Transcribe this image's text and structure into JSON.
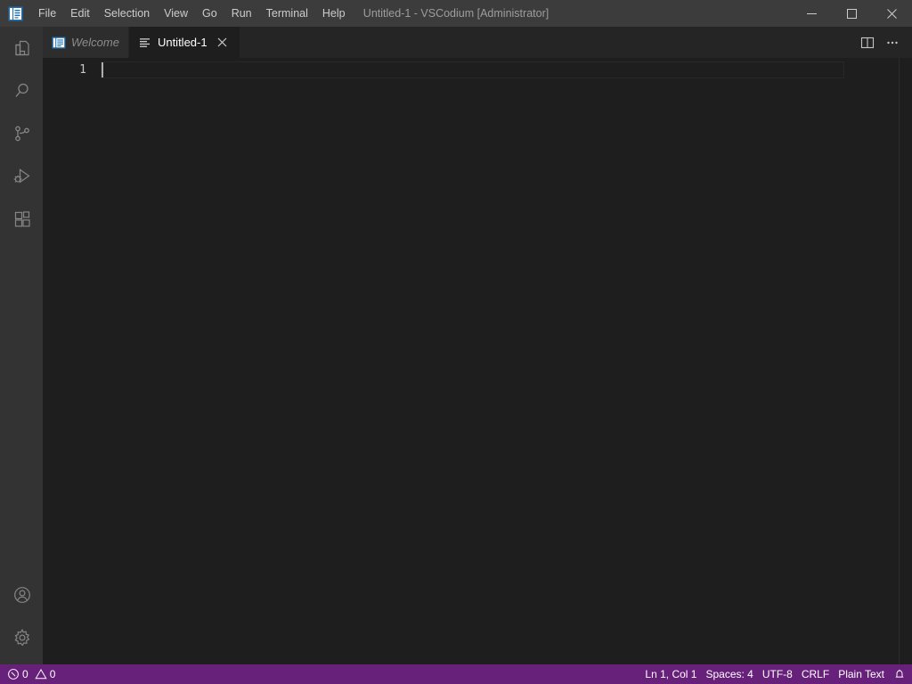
{
  "window": {
    "title": "Untitled-1 - VSCodium [Administrator]",
    "logo_icon": "vscodium-logo-icon",
    "controls": [
      {
        "name": "minimize-button",
        "icon": "minimize-icon",
        "label": "Minimize"
      },
      {
        "name": "maximize-button",
        "icon": "maximize-icon",
        "label": "Maximize"
      },
      {
        "name": "close-button",
        "icon": "close-icon",
        "label": "Close"
      }
    ]
  },
  "menubar": {
    "items": [
      {
        "label": "File"
      },
      {
        "label": "Edit"
      },
      {
        "label": "Selection"
      },
      {
        "label": "View"
      },
      {
        "label": "Go"
      },
      {
        "label": "Run"
      },
      {
        "label": "Terminal"
      },
      {
        "label": "Help"
      }
    ]
  },
  "activitybar": {
    "top_items": [
      {
        "name": "activity-explorer",
        "icon": "files-icon",
        "title": "Explorer",
        "active": false
      },
      {
        "name": "activity-search",
        "icon": "search-icon",
        "title": "Search",
        "active": false
      },
      {
        "name": "activity-source-control",
        "icon": "source-control-icon",
        "title": "Source Control",
        "active": false
      },
      {
        "name": "activity-run-debug",
        "icon": "run-and-debug-icon",
        "title": "Run and Debug",
        "active": false
      },
      {
        "name": "activity-extensions",
        "icon": "extensions-icon",
        "title": "Extensions",
        "active": false
      }
    ],
    "bottom_items": [
      {
        "name": "activity-accounts",
        "icon": "account-icon",
        "title": "Accounts"
      },
      {
        "name": "activity-settings",
        "icon": "gear-icon",
        "title": "Manage"
      }
    ]
  },
  "tabs": [
    {
      "label": "Welcome",
      "icon": "welcome-preview-icon",
      "active": false,
      "preview": true,
      "closable": false
    },
    {
      "label": "Untitled-1",
      "icon": "plaintext-file-icon",
      "active": true,
      "preview": false,
      "closable": true
    }
  ],
  "editor_actions": [
    {
      "name": "split-editor-right-button",
      "icon": "split-editor-icon",
      "label": "Split Editor Right"
    },
    {
      "name": "more-actions-button",
      "icon": "ellipsis-icon",
      "label": "More Actions..."
    }
  ],
  "editor": {
    "line_numbers": [
      "1"
    ],
    "content": "",
    "cursor_line": 1
  },
  "statusbar": {
    "problems": {
      "errors_icon": "error-icon",
      "errors": "0",
      "warnings_icon": "warning-icon",
      "warnings": "0"
    },
    "right_items": [
      {
        "name": "status-cursor-position",
        "label": "Ln 1, Col 1"
      },
      {
        "name": "status-indentation",
        "label": "Spaces: 4"
      },
      {
        "name": "status-encoding",
        "label": "UTF-8"
      },
      {
        "name": "status-eol",
        "label": "CRLF"
      },
      {
        "name": "status-language-mode",
        "label": "Plain Text"
      }
    ],
    "notifications_icon": "bell-icon"
  },
  "colors": {
    "titlebar_bg": "#3c3c3c",
    "activitybar_bg": "#333333",
    "tabbar_bg": "#252526",
    "tab_inactive_bg": "#2d2d2d",
    "editor_bg": "#1e1e1e",
    "statusbar_bg": "#68217a",
    "accent_blue": "#0078d4",
    "foreground": "#cccccc"
  }
}
